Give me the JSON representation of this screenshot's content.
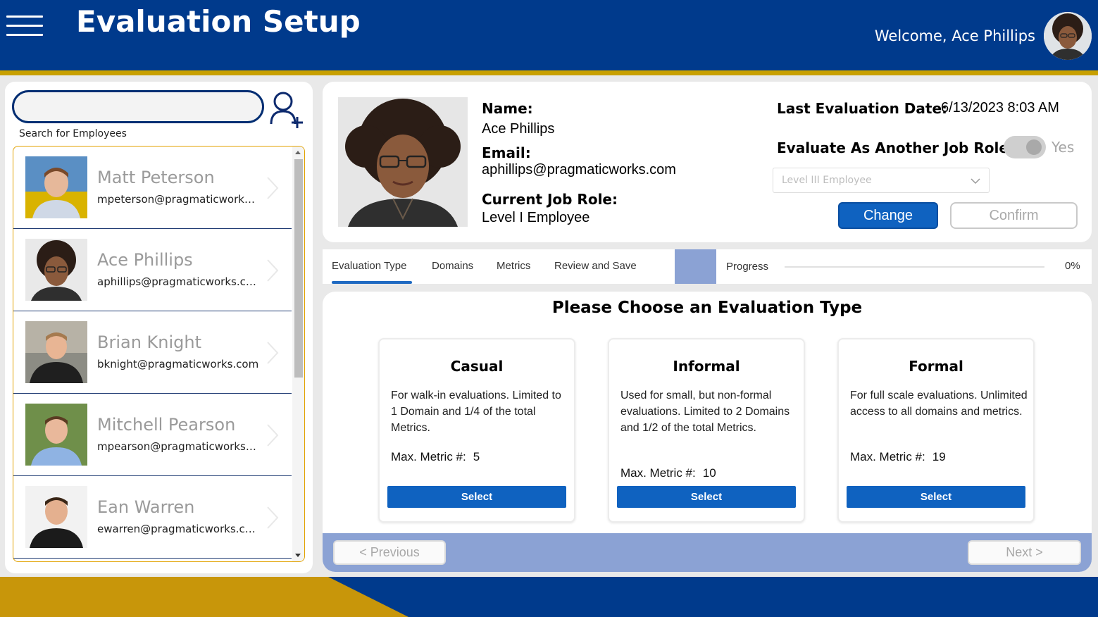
{
  "header": {
    "title": "Evaluation Setup",
    "welcome": "Welcome, Ace Phillips",
    "menu_icon": "hamburger-menu-icon"
  },
  "colors": {
    "header_blue": "#003a8c",
    "accent_gold": "#c8a000",
    "button_blue": "#0f62c0",
    "nav_bar": "#8ba2d4"
  },
  "search": {
    "value": "",
    "placeholder": "",
    "label": "Search for Employees",
    "add_icon": "add-user-icon"
  },
  "employees": [
    {
      "name": "Matt Peterson",
      "email": "mpeterson@pragmaticworks...."
    },
    {
      "name": "Ace Phillips",
      "email": "aphillips@pragmaticworks.com"
    },
    {
      "name": "Brian Knight",
      "email": "bknight@pragmaticworks.com"
    },
    {
      "name": "Mitchell Pearson",
      "email": "mpearson@pragmaticworks.c..."
    },
    {
      "name": "Ean Warren",
      "email": "ewarren@pragmaticworks.com"
    }
  ],
  "profile": {
    "name_label": "Name:",
    "name": "Ace Phillips",
    "email_label": "Email:",
    "email": "aphillips@pragmaticworks.com",
    "role_label": "Current Job Role:",
    "role": "Level I Employee",
    "last_eval_label": "Last Evaluation Date:",
    "last_eval_date": "6/13/2023 8:03 AM",
    "evaluate_as_label": "Evaluate As Another Job Role?",
    "toggle_label": "Yes",
    "role_select_value": "Level III Employee",
    "change_label": "Change",
    "confirm_label": "Confirm"
  },
  "tabs": [
    {
      "label": "Evaluation Type"
    },
    {
      "label": "Domains"
    },
    {
      "label": "Metrics"
    },
    {
      "label": "Review and Save"
    }
  ],
  "progress": {
    "label": "Progress",
    "value": "0%",
    "fraction": 0
  },
  "main": {
    "title": "Please Choose an Evaluation Type",
    "cards": [
      {
        "title": "Casual",
        "description": "For walk-in evaluations. Limited to 1 Domain and 1/4 of the total Metrics.",
        "max_label": "Max. Metric #:",
        "max_value": "5",
        "select_label": "Select"
      },
      {
        "title": "Informal",
        "description": "Used for small, but non-formal evaluations. Limited to 2 Domains and 1/2 of the total Metrics.",
        "max_label": "Max. Metric #:",
        "max_value": "10",
        "select_label": "Select"
      },
      {
        "title": "Formal",
        "description": "For full scale evaluations. Unlimited access to all domains and metrics.",
        "max_label": "Max. Metric #:",
        "max_value": "19",
        "select_label": "Select"
      }
    ],
    "previous_label": "< Previous",
    "next_label": "Next >"
  }
}
